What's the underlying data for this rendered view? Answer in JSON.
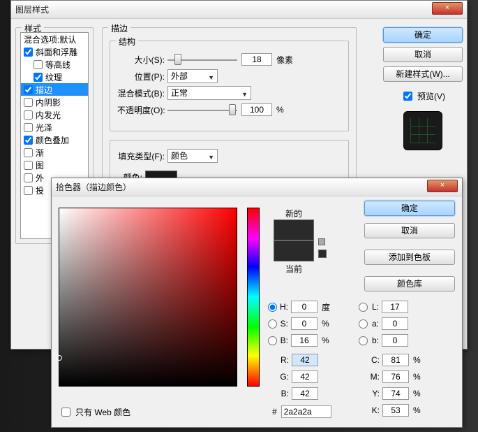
{
  "layer_style_dialog": {
    "title": "图层样式",
    "close": "×",
    "styles_header": "样式",
    "blend_options": "混合选项:默认",
    "items": [
      {
        "label": "斜面和浮雕",
        "checked": true,
        "sub": false
      },
      {
        "label": "等高线",
        "checked": false,
        "sub": true
      },
      {
        "label": "纹理",
        "checked": true,
        "sub": true
      },
      {
        "label": "描边",
        "checked": true,
        "sub": false,
        "selected": true
      },
      {
        "label": "内阴影",
        "checked": false,
        "sub": false
      },
      {
        "label": "内发光",
        "checked": false,
        "sub": false
      },
      {
        "label": "光泽",
        "checked": false,
        "sub": false
      },
      {
        "label": "颜色叠加",
        "checked": true,
        "sub": false,
        "cut": true
      },
      {
        "label": "渐",
        "checked": false,
        "sub": false,
        "cut": true
      },
      {
        "label": "图",
        "checked": false,
        "sub": false,
        "cut": true
      },
      {
        "label": "外",
        "checked": false,
        "sub": false,
        "cut": true
      },
      {
        "label": "投",
        "checked": false,
        "sub": false,
        "cut": true
      }
    ],
    "stroke_group": "描边",
    "structure": "结构",
    "size_label": "大小(S):",
    "size_value": "18",
    "size_unit": "像素",
    "position_label": "位置(P):",
    "position_value": "外部",
    "blendmode_label": "混合模式(B):",
    "blendmode_value": "正常",
    "opacity_label": "不透明度(O):",
    "opacity_value": "100",
    "opacity_unit": "%",
    "filltype_label": "填充类型(F):",
    "filltype_value": "颜色",
    "color_label": "颜色:",
    "ok": "确定",
    "cancel": "取消",
    "newstyle": "新建样式(W)...",
    "preview": "预览(V)"
  },
  "color_picker": {
    "title": "拾色器（描边颜色）",
    "close": "×",
    "new_label": "新的",
    "current_label": "当前",
    "ok": "确定",
    "cancel": "取消",
    "add": "添加到色板",
    "lib": "颜色库",
    "web_only": "只有 Web 颜色",
    "hex_prefix": "#",
    "hex": "2a2a2a",
    "H": {
      "k": "H:",
      "v": "0",
      "u": "度"
    },
    "S": {
      "k": "S:",
      "v": "0",
      "u": "%"
    },
    "Bv": {
      "k": "B:",
      "v": "16",
      "u": "%"
    },
    "R": {
      "k": "R:",
      "v": "42"
    },
    "G": {
      "k": "G:",
      "v": "42"
    },
    "Bb": {
      "k": "B:",
      "v": "42"
    },
    "L": {
      "k": "L:",
      "v": "17"
    },
    "a": {
      "k": "a:",
      "v": "0"
    },
    "b": {
      "k": "b:",
      "v": "0"
    },
    "C": {
      "k": "C:",
      "v": "81",
      "u": "%"
    },
    "M": {
      "k": "M:",
      "v": "76",
      "u": "%"
    },
    "Y": {
      "k": "Y:",
      "v": "74",
      "u": "%"
    },
    "K": {
      "k": "K:",
      "v": "53",
      "u": "%"
    },
    "hue_base": "#ff0000",
    "new_color": "#2a2a2a",
    "current_color": "#2a2a2a"
  }
}
